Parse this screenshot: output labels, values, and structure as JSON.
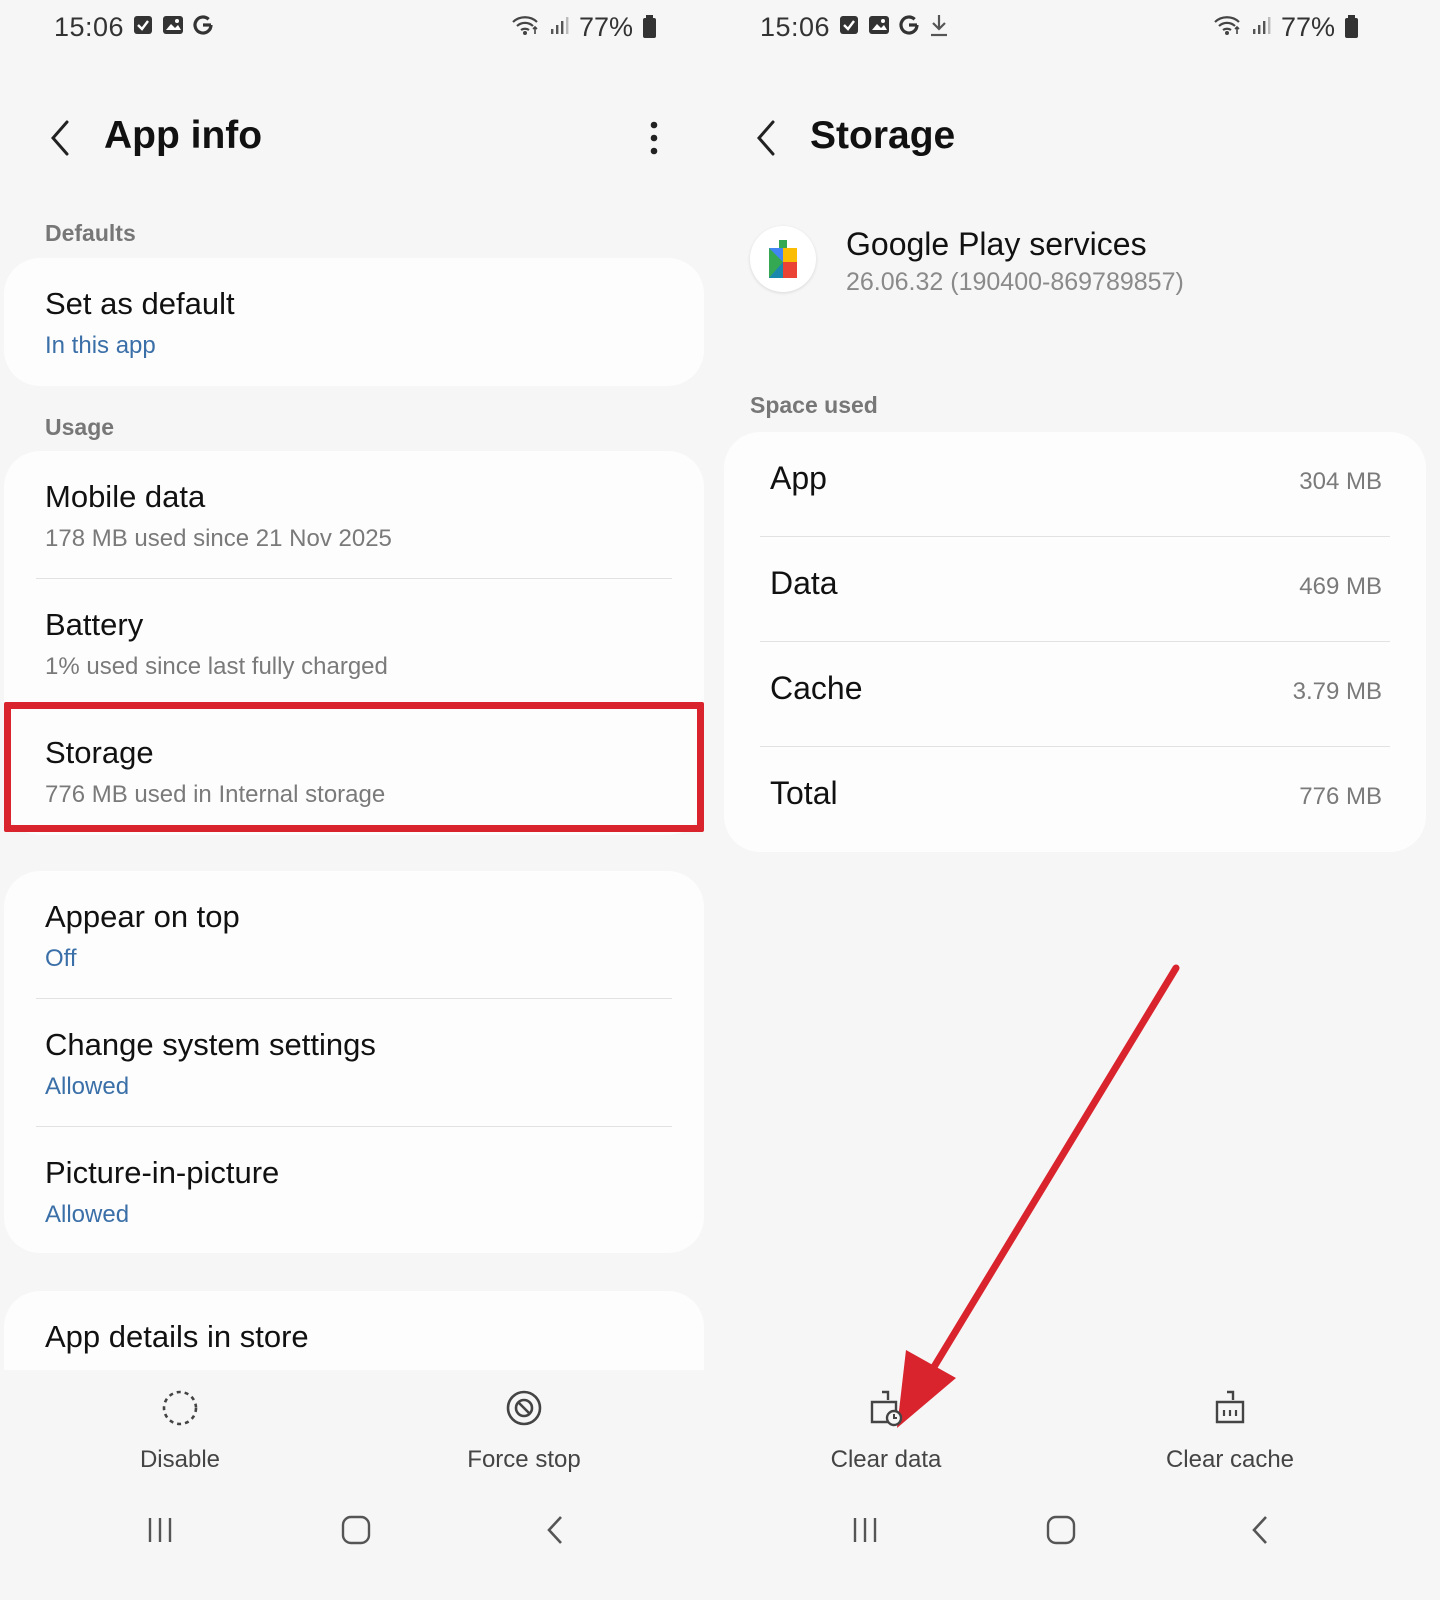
{
  "left": {
    "status": {
      "time": "15:06",
      "battery": "77%"
    },
    "header": {
      "title": "App info"
    },
    "sections": {
      "defaults": "Defaults",
      "usage": "Usage"
    },
    "defaults_items": [
      {
        "title": "Set as default",
        "subtitle": "In this app"
      }
    ],
    "usage_items": [
      {
        "title": "Mobile data",
        "subtitle": "178 MB used since 21 Nov 2025"
      },
      {
        "title": "Battery",
        "subtitle": "1% used since last fully charged"
      },
      {
        "title": "Storage",
        "subtitle": "776 MB used in Internal storage"
      }
    ],
    "perm_items": [
      {
        "title": "Appear on top",
        "subtitle": "Off"
      },
      {
        "title": "Change system settings",
        "subtitle": "Allowed"
      },
      {
        "title": "Picture-in-picture",
        "subtitle": "Allowed"
      }
    ],
    "store_item": {
      "title": "App details in store"
    },
    "actions": {
      "disable": "Disable",
      "force_stop": "Force stop"
    }
  },
  "right": {
    "status": {
      "time": "15:06",
      "battery": "77%"
    },
    "header": {
      "title": "Storage"
    },
    "app": {
      "name": "Google Play services",
      "version": "26.06.32 (190400-869789857)"
    },
    "section_label": "Space used",
    "rows": [
      {
        "label": "App",
        "value": "304 MB"
      },
      {
        "label": "Data",
        "value": "469 MB"
      },
      {
        "label": "Cache",
        "value": "3.79 MB"
      },
      {
        "label": "Total",
        "value": "776 MB"
      }
    ],
    "actions": {
      "clear_data": "Clear data",
      "clear_cache": "Clear cache"
    }
  },
  "colors": {
    "highlight": "#d9242e",
    "link_blue": "#3b6fa8",
    "background": "#f6f6f6"
  }
}
